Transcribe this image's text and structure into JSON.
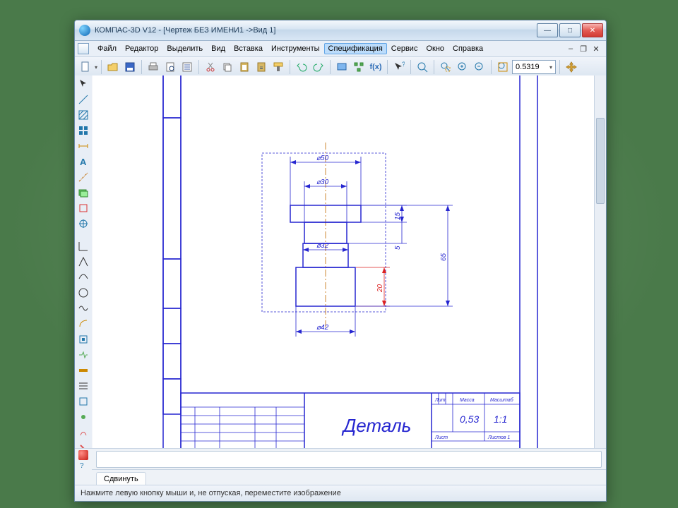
{
  "title": "КОМПАС-3D V12 - [Чертеж БЕЗ ИМЕНИ1 ->Вид 1]",
  "menu": {
    "items": [
      "Файл",
      "Редактор",
      "Выделить",
      "Вид",
      "Вставка",
      "Инструменты",
      "Спецификация",
      "Сервис",
      "Окно",
      "Справка"
    ],
    "selected_index": 6
  },
  "toolbar": {
    "zoom_value": "0.5319",
    "icons": [
      "new-doc",
      "open",
      "save",
      "print",
      "print-preview",
      "props",
      "cut",
      "copy",
      "paste",
      "undo-list",
      "format-painter",
      "undo",
      "redo",
      "screen",
      "tree",
      "fx",
      "whatsthis",
      "zoom",
      "zoom-window",
      "zoom-in",
      "zoom-out",
      "zoom-fit",
      "pan"
    ],
    "fx_label": "f(x)"
  },
  "left_tools": [
    "select",
    "line",
    "circle",
    "hatch",
    "dimension",
    "text",
    "axis",
    "layers",
    "snap",
    "grid",
    "ortho",
    "polar",
    "ref",
    "filter",
    "down",
    "sym",
    "chain",
    "poly",
    "break",
    "edit",
    "t1",
    "t2",
    "t3",
    "t4"
  ],
  "drawing": {
    "title_block_name": "Деталь",
    "title_block": {
      "lit": "Лит.",
      "mass": "Масса",
      "scale": "Масштаб",
      "mass_val": "0,53",
      "scale_val": "1:1",
      "sheet": "Лист",
      "sheets": "Листов 1"
    },
    "dims": {
      "d50": "⌀50",
      "d30": "⌀30",
      "d32": "⌀32",
      "d42": "⌀42",
      "h65": "65",
      "h15": "15",
      "h5": "5",
      "h20": "20"
    }
  },
  "property_tab": "Сдвинуть",
  "status": "Нажмите левую кнопку мыши и, не отпуская, переместите изображение",
  "colors": {
    "frame": "#2626d0",
    "accent": "#d22"
  }
}
